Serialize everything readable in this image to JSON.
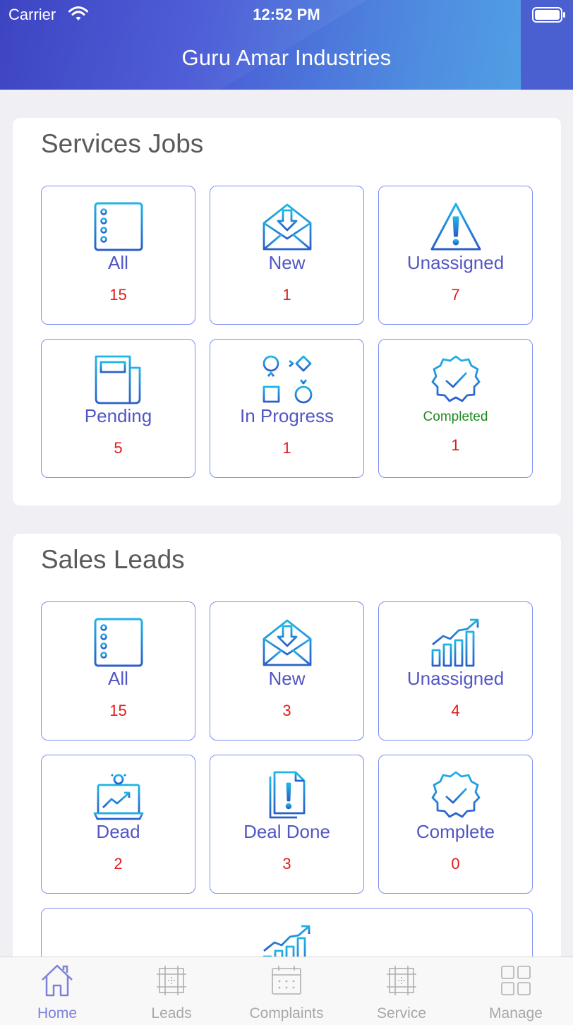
{
  "status_bar": {
    "carrier": "Carrier",
    "time": "12:52 PM"
  },
  "header": {
    "title": "Guru Amar Industries"
  },
  "colors": {
    "accent": "#5156c4",
    "count": "#e11b1b",
    "completed": "#1e8a1e",
    "tile_border": "#7c8ff0"
  },
  "services": {
    "title": "Services Jobs",
    "tiles": [
      {
        "label": "All",
        "count": "15",
        "icon": "list-icon"
      },
      {
        "label": "New",
        "count": "1",
        "icon": "envelope-download-icon"
      },
      {
        "label": "Unassigned",
        "count": "7",
        "icon": "warning-icon"
      },
      {
        "label": "Pending",
        "count": "5",
        "icon": "newspaper-icon"
      },
      {
        "label": "In Progress",
        "count": "1",
        "icon": "flowchart-icon"
      },
      {
        "label": "Completed",
        "count": "1",
        "icon": "check-badge-icon"
      }
    ]
  },
  "sales": {
    "title": "Sales Leads",
    "tiles": [
      {
        "label": "All",
        "count": "15",
        "icon": "list-icon"
      },
      {
        "label": "New",
        "count": "3",
        "icon": "envelope-download-icon"
      },
      {
        "label": "Unassigned",
        "count": "4",
        "icon": "growth-chart-icon"
      },
      {
        "label": "Dead",
        "count": "2",
        "icon": "laptop-idea-icon"
      },
      {
        "label": "Deal Done",
        "count": "3",
        "icon": "documents-alert-icon"
      },
      {
        "label": "Complete",
        "count": "0",
        "icon": "check-badge-icon"
      }
    ],
    "partial_tile_icon": "growth-chart-icon"
  },
  "tabbar": {
    "items": [
      {
        "label": "Home",
        "icon": "home-icon",
        "active": true
      },
      {
        "label": "Leads",
        "icon": "grid-frame-icon",
        "active": false
      },
      {
        "label": "Complaints",
        "icon": "calendar-icon",
        "active": false
      },
      {
        "label": "Service",
        "icon": "grid-frame-icon",
        "active": false
      },
      {
        "label": "Manage",
        "icon": "four-squares-icon",
        "active": false
      }
    ]
  }
}
